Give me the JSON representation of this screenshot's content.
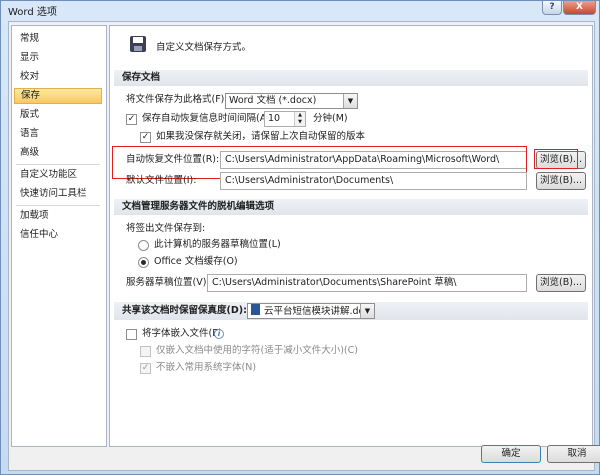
{
  "window": {
    "title": "Word 选项",
    "help_label": "?",
    "close_label": "X"
  },
  "nav": {
    "items": [
      {
        "label": "常规",
        "selected": false
      },
      {
        "label": "显示",
        "selected": false
      },
      {
        "label": "校对",
        "selected": false
      },
      {
        "label": "保存",
        "selected": true
      },
      {
        "label": "版式",
        "selected": false
      },
      {
        "label": "语言",
        "selected": false
      },
      {
        "label": "高级",
        "selected": false
      },
      {
        "label": "自定义功能区",
        "selected": false
      },
      {
        "label": "快速访问工具栏",
        "selected": false
      },
      {
        "label": "加载项",
        "selected": false
      },
      {
        "label": "信任中心",
        "selected": false
      }
    ]
  },
  "header": {
    "text": "自定义文档保存方式。"
  },
  "save_docs": {
    "section_title": "保存文档",
    "format_label": "将文件保存为此格式(F):",
    "format_value": "Word 文档 (*.docx)",
    "autorecover_label": "保存自动恢复信息时间间隔(A)",
    "autorecover_checked": true,
    "autorecover_minutes": "10",
    "minutes_unit": "分钟(M)",
    "keep_last_label": "如果我没保存就关闭，请保留上次自动保留的版本",
    "keep_last_checked": true,
    "autorecover_location_label": "自动恢复文件位置(R):",
    "autorecover_location_value": "C:\\Users\\Administrator\\AppData\\Roaming\\Microsoft\\Word\\",
    "default_location_label": "默认文件位置(I):",
    "default_location_value": "C:\\Users\\Administrator\\Documents\\",
    "browse_label": "浏览(B)...",
    "browse_label_2": "浏览(B)..."
  },
  "offline": {
    "section_title": "文档管理服务器文件的脱机编辑选项",
    "save_to_label": "将签出文件保存到:",
    "option_server": "此计算机的服务器草稿位置(L)",
    "option_office": "Office 文档缓存(O)",
    "selected_option": "office",
    "drafts_label": "服务器草稿位置(V):",
    "drafts_value": "C:\\Users\\Administrator\\Documents\\SharePoint 草稿\\",
    "browse_label": "浏览(B)..."
  },
  "fidelity": {
    "section_title": "共享该文档时保留保真度(D):",
    "doc_name": "云平台短信模块讲解.docx",
    "embed_fonts_label": "将字体嵌入文件(E)",
    "embed_fonts_checked": false,
    "embed_used_only_label": "仅嵌入文档中使用的字符(适于减小文件大小)(C)",
    "embed_used_only_checked": false,
    "no_common_fonts_label": "不嵌入常用系统字体(N)",
    "no_common_fonts_checked": true
  },
  "footer": {
    "ok_label": "确定",
    "cancel_label": "取消"
  },
  "colors": {
    "highlight": "#e02020",
    "selected_nav": "#f7c864"
  }
}
